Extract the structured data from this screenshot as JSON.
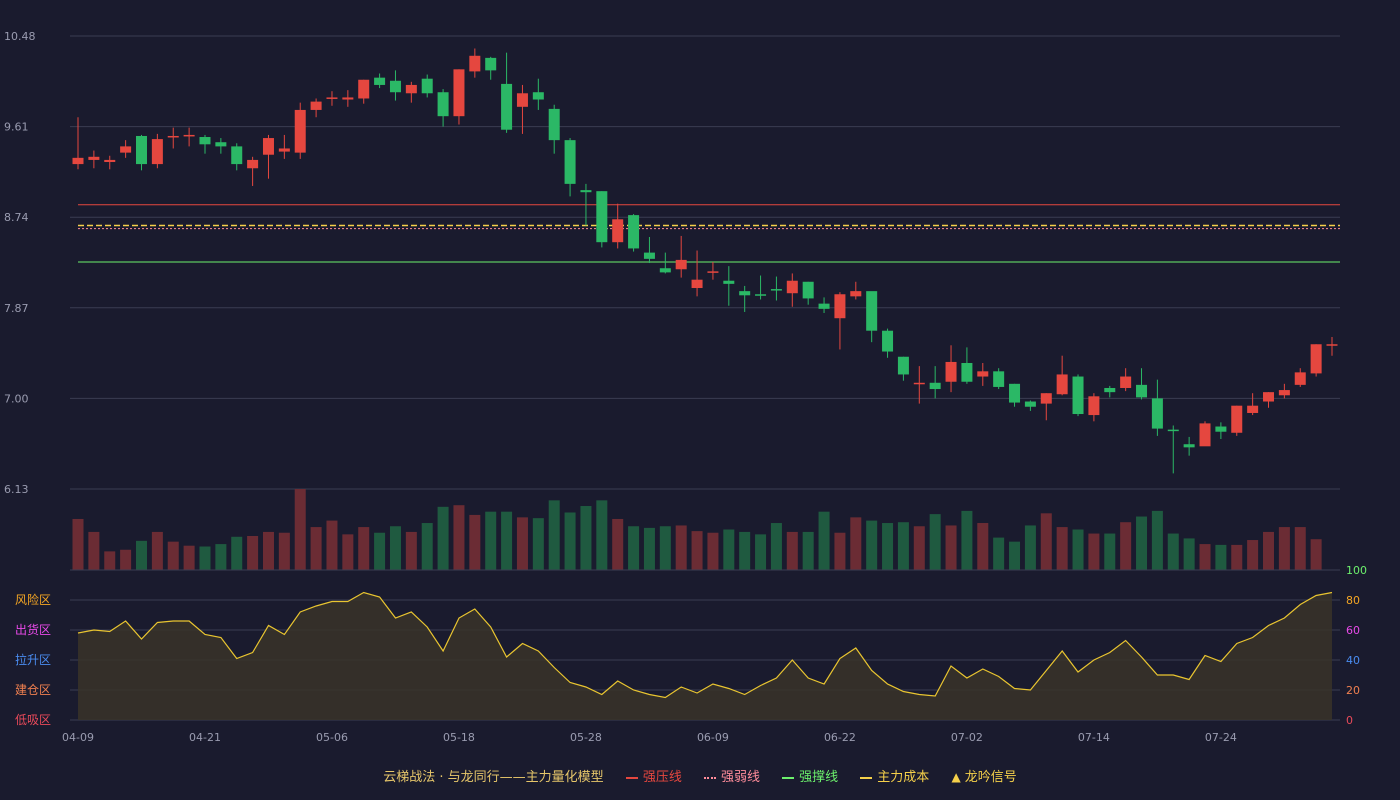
{
  "chart_data": {
    "type": "candlestick",
    "title": "云梯战法 · 与龙同行——主力量化模型",
    "price_axis": {
      "ticks": [
        10.48,
        9.61,
        8.74,
        7.87,
        7.0,
        6.13
      ],
      "range": [
        6.13,
        10.48
      ]
    },
    "x_ticks": [
      "04-09",
      "04-21",
      "05-06",
      "05-18",
      "05-28",
      "06-09",
      "06-22",
      "07-02",
      "07-14",
      "07-24"
    ],
    "candles": [
      [
        9.25,
        9.31,
        9.7,
        9.2
      ],
      [
        9.29,
        9.32,
        9.38,
        9.21
      ],
      [
        9.27,
        9.29,
        9.33,
        9.2
      ],
      [
        9.36,
        9.42,
        9.48,
        9.31
      ],
      [
        9.52,
        9.25,
        9.53,
        9.19
      ],
      [
        9.25,
        9.49,
        9.54,
        9.21
      ],
      [
        9.52,
        9.52,
        9.6,
        9.4
      ],
      [
        9.53,
        9.53,
        9.6,
        9.42
      ],
      [
        9.51,
        9.44,
        9.53,
        9.35
      ],
      [
        9.46,
        9.42,
        9.5,
        9.35
      ],
      [
        9.42,
        9.25,
        9.45,
        9.19
      ],
      [
        9.21,
        9.29,
        9.32,
        9.04
      ],
      [
        9.34,
        9.5,
        9.53,
        9.11
      ],
      [
        9.37,
        9.4,
        9.53,
        9.3
      ],
      [
        9.36,
        9.77,
        9.84,
        9.3
      ],
      [
        9.77,
        9.85,
        9.88,
        9.7
      ],
      [
        9.89,
        9.89,
        9.95,
        9.81
      ],
      [
        9.87,
        9.89,
        9.96,
        9.8
      ],
      [
        9.88,
        10.06,
        10.06,
        9.83
      ],
      [
        10.08,
        10.01,
        10.12,
        9.98
      ],
      [
        10.05,
        9.94,
        10.15,
        9.86
      ],
      [
        9.93,
        10.01,
        10.04,
        9.84
      ],
      [
        10.07,
        9.93,
        10.11,
        9.89
      ],
      [
        9.94,
        9.71,
        9.97,
        9.61
      ],
      [
        9.71,
        10.16,
        10.16,
        9.63
      ],
      [
        10.14,
        10.29,
        10.36,
        10.08
      ],
      [
        10.27,
        10.15,
        10.28,
        10.06
      ],
      [
        10.02,
        9.58,
        10.32,
        9.55
      ],
      [
        9.8,
        9.93,
        10.01,
        9.54
      ],
      [
        9.94,
        9.87,
        10.07,
        9.77
      ],
      [
        9.78,
        9.48,
        9.82,
        9.35
      ],
      [
        9.48,
        9.06,
        9.5,
        8.94
      ],
      [
        9.0,
        8.98,
        9.06,
        8.66
      ],
      [
        8.99,
        8.5,
        8.99,
        8.45
      ],
      [
        8.5,
        8.72,
        8.87,
        8.44
      ],
      [
        8.76,
        8.44,
        8.77,
        8.41
      ],
      [
        8.4,
        8.34,
        8.55,
        8.3
      ],
      [
        8.25,
        8.21,
        8.4,
        8.2
      ],
      [
        8.24,
        8.33,
        8.56,
        8.16
      ],
      [
        8.06,
        8.14,
        8.42,
        7.98
      ],
      [
        8.22,
        8.22,
        8.31,
        8.14
      ],
      [
        8.13,
        8.1,
        8.27,
        7.89
      ],
      [
        8.03,
        7.99,
        8.08,
        7.83
      ],
      [
        8.0,
        7.99,
        8.18,
        7.95
      ],
      [
        8.05,
        8.04,
        8.17,
        7.94
      ],
      [
        8.01,
        8.13,
        8.2,
        7.88
      ],
      [
        8.12,
        7.96,
        8.12,
        7.9
      ],
      [
        7.91,
        7.86,
        7.97,
        7.82
      ],
      [
        7.77,
        8.0,
        8.02,
        7.47
      ],
      [
        7.98,
        8.03,
        8.12,
        7.95
      ],
      [
        8.03,
        7.65,
        8.02,
        7.54
      ],
      [
        7.65,
        7.45,
        7.67,
        7.39
      ],
      [
        7.4,
        7.23,
        7.4,
        7.17
      ],
      [
        7.15,
        7.15,
        7.31,
        6.95
      ],
      [
        7.15,
        7.09,
        7.31,
        7.0
      ],
      [
        7.16,
        7.35,
        7.51,
        7.06
      ],
      [
        7.34,
        7.16,
        7.49,
        7.14
      ],
      [
        7.21,
        7.26,
        7.34,
        7.12
      ],
      [
        7.26,
        7.11,
        7.29,
        7.09
      ],
      [
        7.14,
        6.96,
        7.14,
        6.92
      ],
      [
        6.97,
        6.92,
        6.98,
        6.88
      ],
      [
        6.95,
        7.05,
        7.05,
        6.79
      ],
      [
        7.04,
        7.23,
        7.41,
        7.03
      ],
      [
        7.21,
        6.85,
        7.23,
        6.83
      ],
      [
        6.84,
        7.02,
        7.05,
        6.78
      ],
      [
        7.1,
        7.06,
        7.12,
        7.01
      ],
      [
        7.1,
        7.21,
        7.29,
        7.07
      ],
      [
        7.13,
        7.01,
        7.29,
        6.99
      ],
      [
        7.0,
        6.71,
        7.18,
        6.64
      ],
      [
        6.7,
        6.69,
        6.74,
        6.28
      ],
      [
        6.56,
        6.53,
        6.63,
        6.45
      ],
      [
        6.54,
        6.76,
        6.78,
        6.55
      ],
      [
        6.73,
        6.68,
        6.77,
        6.61
      ],
      [
        6.67,
        6.93,
        6.93,
        6.64
      ],
      [
        6.86,
        6.93,
        7.05,
        6.84
      ],
      [
        6.97,
        7.06,
        7.06,
        6.91
      ],
      [
        7.03,
        7.08,
        7.14,
        7.0
      ],
      [
        7.13,
        7.25,
        7.29,
        7.11
      ],
      [
        7.24,
        7.52,
        7.52,
        7.21
      ],
      [
        7.51,
        7.52,
        7.59,
        7.41
      ]
    ],
    "volume": [
      0.63,
      0.47,
      0.23,
      0.25,
      0.36,
      0.47,
      0.35,
      0.3,
      0.29,
      0.32,
      0.41,
      0.42,
      0.47,
      0.46,
      1.0,
      0.53,
      0.61,
      0.44,
      0.53,
      0.46,
      0.54,
      0.47,
      0.58,
      0.78,
      0.8,
      0.68,
      0.72,
      0.72,
      0.65,
      0.64,
      0.86,
      0.71,
      0.79,
      0.86,
      0.63,
      0.54,
      0.52,
      0.54,
      0.55,
      0.48,
      0.46,
      0.5,
      0.47,
      0.44,
      0.58,
      0.47,
      0.47,
      0.72,
      0.46,
      0.65,
      0.61,
      0.58,
      0.59,
      0.54,
      0.69,
      0.55,
      0.73,
      0.58,
      0.4,
      0.35,
      0.55,
      0.7,
      0.53,
      0.5,
      0.45,
      0.45,
      0.59,
      0.66,
      0.73,
      0.45,
      0.39,
      0.32,
      0.31,
      0.31,
      0.37,
      0.47,
      0.53,
      0.53,
      0.38
    ],
    "indicator": {
      "ticks": [
        0,
        20,
        40,
        60,
        80,
        100
      ],
      "values": [
        58,
        60,
        59,
        66,
        54,
        65,
        66,
        66,
        57,
        55,
        41,
        45,
        63,
        57,
        72,
        76,
        79,
        79,
        85,
        82,
        68,
        72,
        62,
        46,
        68,
        74,
        62,
        42,
        51,
        46,
        35,
        25,
        22,
        17,
        26,
        20,
        17,
        15,
        22,
        18,
        24,
        21,
        17,
        23,
        28,
        40,
        28,
        24,
        41,
        48,
        33,
        24,
        19,
        17,
        16,
        36,
        28,
        34,
        29,
        21,
        20,
        33,
        46,
        32,
        40,
        45,
        53,
        42,
        30,
        30,
        27,
        43,
        39,
        51,
        55,
        63,
        68,
        77,
        83,
        85
      ],
      "zones": [
        "风险区",
        "出货区",
        "拉升区",
        "建仓区",
        "低吸区"
      ]
    },
    "levels": {
      "strong_pressure": 8.86,
      "strong_weak": 8.63,
      "main_cost": 8.66,
      "strong_support": 8.31
    },
    "legend": [
      "强压线",
      "强弱线",
      "强撑线",
      "主力成本",
      "龙吟信号"
    ]
  },
  "colors": {
    "background": "#1a1b2e",
    "up": "#e5473f",
    "down": "#2bb866",
    "indicator": "#e9c530",
    "pressure": "#e5473f",
    "weak": "#ff8c9a",
    "support": "#6cf06c",
    "cost": "#f5d04a"
  },
  "zone_colors": [
    "#f5a623",
    "#e94ae9",
    "#4a8cf0",
    "#f08050",
    "#e94a5a"
  ]
}
